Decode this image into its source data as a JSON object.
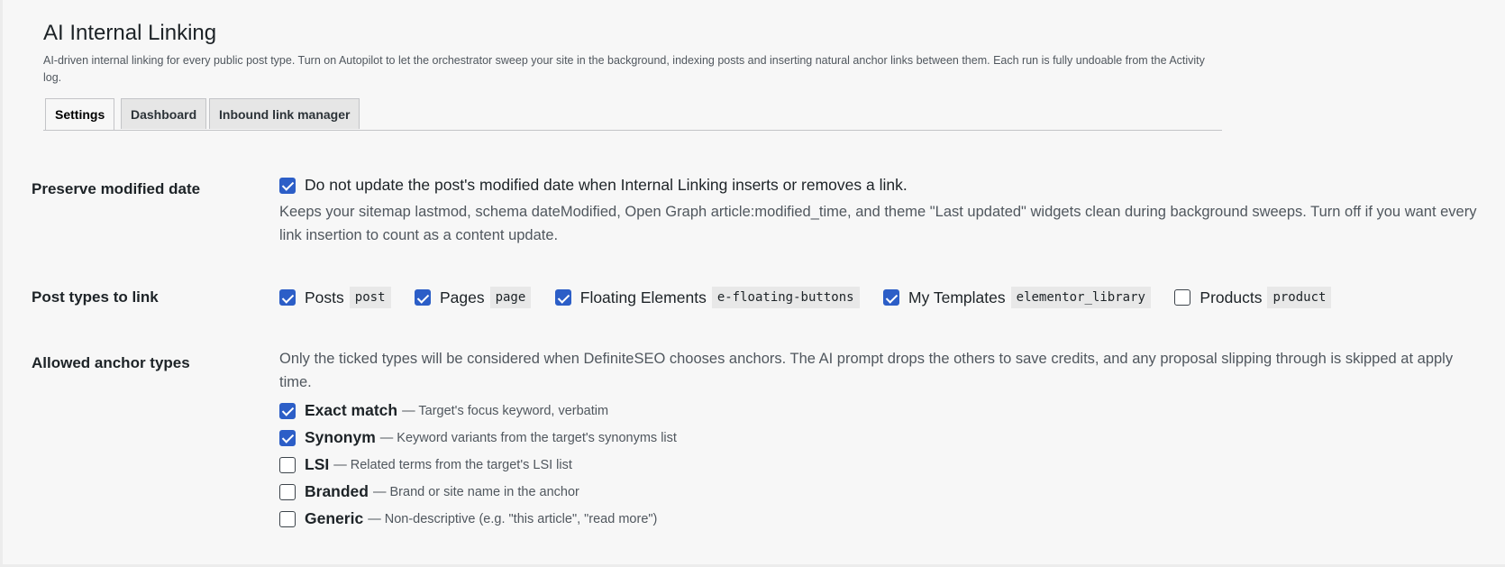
{
  "page": {
    "title": "AI Internal Linking",
    "description": "AI-driven internal linking for every public post type. Turn on Autopilot to let the orchestrator sweep your site in the background, indexing posts and inserting natural anchor links between them. Each run is fully undoable from the Activity log."
  },
  "tabs": [
    {
      "label": "Settings",
      "active": true
    },
    {
      "label": "Dashboard",
      "active": false
    },
    {
      "label": "Inbound link manager",
      "active": false
    }
  ],
  "preserve": {
    "label": "Preserve modified date",
    "checkbox_label": "Do not update the post's modified date when Internal Linking inserts or removes a link.",
    "checked": true,
    "help": "Keeps your sitemap lastmod, schema dateModified, Open Graph article:modified_time, and theme \"Last updated\" widgets clean during background sweeps. Turn off if you want every link insertion to count as a content update."
  },
  "post_types": {
    "label": "Post types to link",
    "items": [
      {
        "label": "Posts",
        "slug": "post",
        "checked": true
      },
      {
        "label": "Pages",
        "slug": "page",
        "checked": true
      },
      {
        "label": "Floating Elements",
        "slug": "e-floating-buttons",
        "checked": true
      },
      {
        "label": "My Templates",
        "slug": "elementor_library",
        "checked": true
      },
      {
        "label": "Products",
        "slug": "product",
        "checked": false
      }
    ]
  },
  "anchor_types": {
    "label": "Allowed anchor types",
    "help": "Only the ticked types will be considered when DefiniteSEO chooses anchors. The AI prompt drops the others to save credits, and any proposal slipping through is skipped at apply time.",
    "items": [
      {
        "name": "Exact match",
        "desc": "— Target's focus keyword, verbatim",
        "checked": true
      },
      {
        "name": "Synonym",
        "desc": "— Keyword variants from the target's synonyms list",
        "checked": true
      },
      {
        "name": "LSI",
        "desc": "— Related terms from the target's LSI list",
        "checked": false
      },
      {
        "name": "Branded",
        "desc": "— Brand or site name in the anchor",
        "checked": false
      },
      {
        "name": "Generic",
        "desc": "— Non-descriptive (e.g. \"this article\", \"read more\")",
        "checked": false
      }
    ]
  },
  "colors": {
    "checkbox_checked": "#2c5ec7",
    "background": "#f7f7f7",
    "text": "#1d2327",
    "muted": "#50575e"
  }
}
